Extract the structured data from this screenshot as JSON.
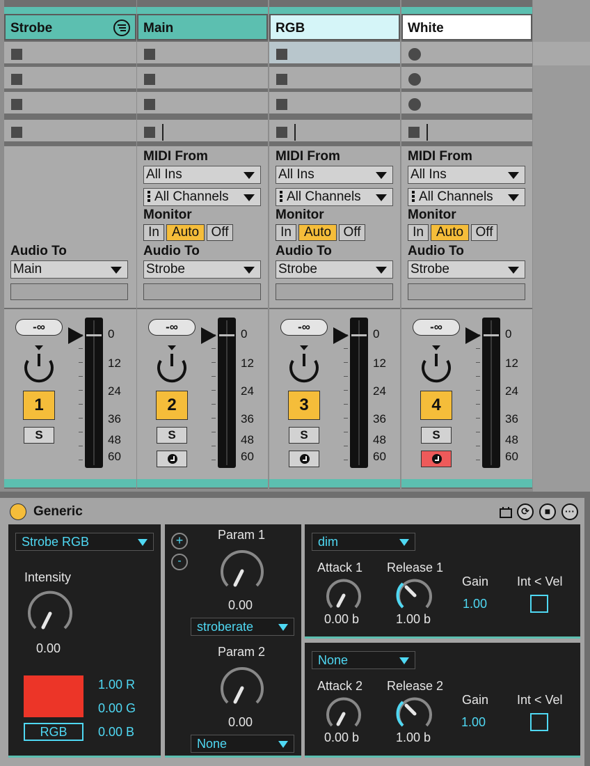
{
  "tracks": [
    {
      "name": "Strobe",
      "color": "#5cbfb0",
      "audio_to": "Main",
      "number": "1",
      "volume": "-∞",
      "solo": "S"
    },
    {
      "name": "Main",
      "color": "#5cbfb0",
      "midi_from": "All Ins",
      "channels": "All Channels",
      "audio_to": "Strobe",
      "number": "2",
      "volume": "-∞",
      "solo": "S"
    },
    {
      "name": "RGB",
      "color": "#d5f5f8",
      "midi_from": "All Ins",
      "channels": "All Channels",
      "audio_to": "Strobe",
      "number": "3",
      "volume": "-∞",
      "solo": "S"
    },
    {
      "name": "White",
      "color": "#ffffff",
      "midi_from": "All Ins",
      "channels": "All Channels",
      "audio_to": "Strobe",
      "number": "4",
      "volume": "-∞",
      "solo": "S",
      "armed": true
    }
  ],
  "labels": {
    "midi_from": "MIDI From",
    "monitor": "Monitor",
    "audio_to": "Audio To",
    "in": "In",
    "auto": "Auto",
    "off": "Off"
  },
  "meter_scale": [
    "0",
    "12",
    "24",
    "36",
    "48",
    "60"
  ],
  "device": {
    "name": "Generic",
    "preset": "Strobe RGB",
    "intensity_label": "Intensity",
    "intensity_value": "0.00",
    "color_button": "RGB",
    "swatch_color": "#ec3528",
    "r": "1.00 R",
    "g": "0.00 G",
    "b": "0.00 B",
    "param1_label": "Param 1",
    "param1_value": "0.00",
    "param1_target": "stroberate",
    "param2_label": "Param 2",
    "param2_value": "0.00",
    "param2_target": "None",
    "env1": {
      "target": "dim",
      "attack_label": "Attack 1",
      "attack_value": "0.00 b",
      "release_label": "Release 1",
      "release_value": "1.00 b",
      "gain_label": "Gain",
      "gain_value": "1.00",
      "int_vel": "Int < Vel"
    },
    "env2": {
      "target": "None",
      "attack_label": "Attack 2",
      "attack_value": "0.00 b",
      "release_label": "Release 2",
      "release_value": "1.00 b",
      "gain_label": "Gain",
      "gain_value": "1.00",
      "int_vel": "Int < Vel"
    }
  }
}
